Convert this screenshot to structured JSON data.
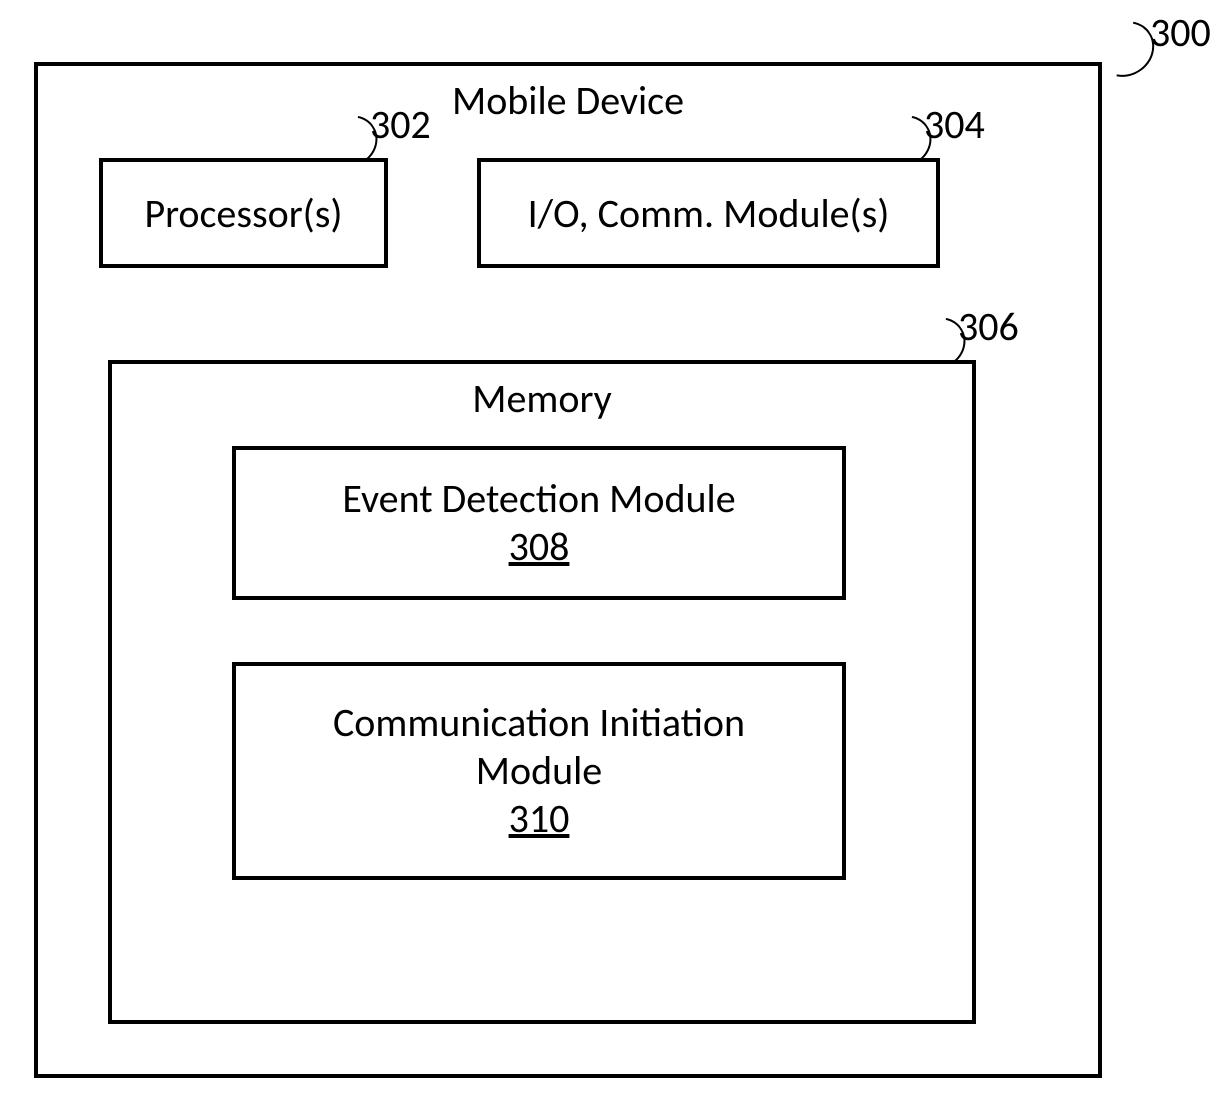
{
  "outer": {
    "ref": "300",
    "title": "Mobile Device"
  },
  "processor": {
    "ref": "302",
    "label": "Processor(s)"
  },
  "io": {
    "ref": "304",
    "label": "I/O, Comm. Module(s)"
  },
  "memory": {
    "ref": "306",
    "title": "Memory"
  },
  "event": {
    "label": "Event Detection Module",
    "ref": "308"
  },
  "comm": {
    "label_line1": "Communication Initiation",
    "label_line2": "Module",
    "ref": "310"
  }
}
